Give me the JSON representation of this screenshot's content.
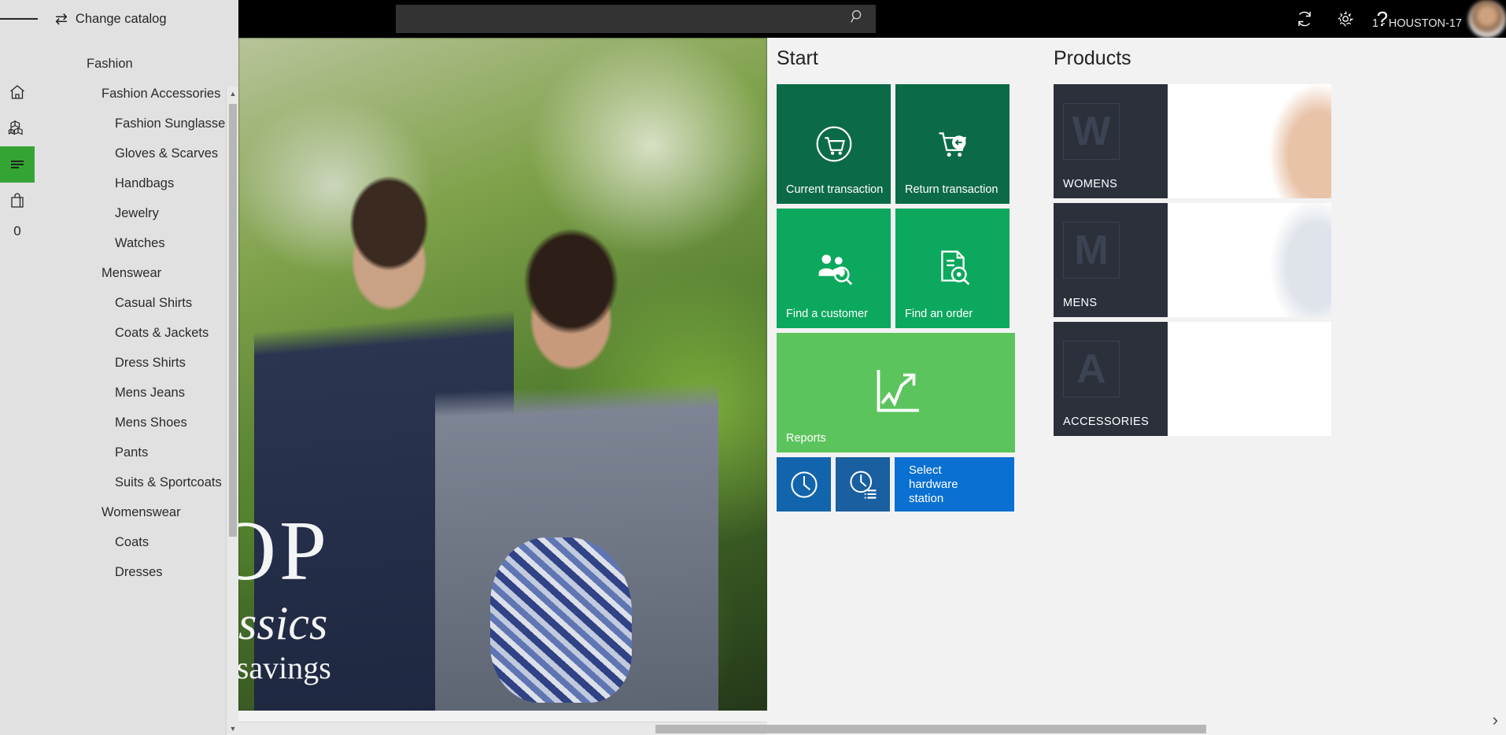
{
  "nav": {
    "hamburger_label": "menu-toggle",
    "change_catalog": "Change catalog",
    "swap_glyph": "⇄",
    "rail": [
      {
        "name": "home",
        "icon": "home-icon"
      },
      {
        "name": "products",
        "icon": "boxes-icon"
      },
      {
        "name": "catalog",
        "icon": "list-icon",
        "active": true
      },
      {
        "name": "cart",
        "icon": "shopping-bag-icon"
      }
    ],
    "cart_count": "0",
    "catalog": [
      {
        "label": "Fashion",
        "level": "group"
      },
      {
        "label": "Fashion Accessories",
        "level": "item"
      },
      {
        "label": "Fashion Sunglasses",
        "level": "sub"
      },
      {
        "label": "Gloves & Scarves",
        "level": "sub"
      },
      {
        "label": "Handbags",
        "level": "sub"
      },
      {
        "label": "Jewelry",
        "level": "sub"
      },
      {
        "label": "Watches",
        "level": "sub"
      },
      {
        "label": "Menswear",
        "level": "item"
      },
      {
        "label": "Casual Shirts",
        "level": "sub"
      },
      {
        "label": "Coats & Jackets",
        "level": "sub"
      },
      {
        "label": "Dress Shirts",
        "level": "sub"
      },
      {
        "label": "Mens Jeans",
        "level": "sub"
      },
      {
        "label": "Mens Shoes",
        "level": "sub"
      },
      {
        "label": "Pants",
        "level": "sub"
      },
      {
        "label": "Suits & Sportcoats",
        "level": "sub"
      },
      {
        "label": "Womenswear",
        "level": "item"
      },
      {
        "label": "Coats",
        "level": "sub"
      },
      {
        "label": "Dresses",
        "level": "sub"
      }
    ],
    "scroll_up_glyph": "▲",
    "scroll_down_glyph": "▼"
  },
  "topbar": {
    "search_placeholder": "",
    "search_value": "",
    "search_icon": "search-icon",
    "refresh_icon": "refresh-icon",
    "settings_icon": "gear-icon",
    "help_icon": "help-icon",
    "help_glyph": "?",
    "user_name": "",
    "store_register": "1 - HOUSTON-17"
  },
  "hero": {
    "line1": "OP",
    "line2": "assics",
    "line3": "e savings",
    "scroll_right_glyph": "›"
  },
  "start": {
    "title": "Start",
    "tiles": [
      {
        "label": "Current transaction",
        "icon": "cart-circle-icon",
        "color": "#0c6b47",
        "size": "sq"
      },
      {
        "label": "Return transaction",
        "icon": "cart-return-icon",
        "color": "#0c6b47",
        "size": "sq"
      },
      {
        "label": "Find a customer",
        "icon": "customers-search-icon",
        "color": "#0ca85e",
        "size": "sq"
      },
      {
        "label": "Find an order",
        "icon": "order-search-icon",
        "color": "#0ca85e",
        "size": "sq"
      },
      {
        "label": "Reports",
        "icon": "chart-up-icon",
        "color": "#5cc45c",
        "size": "wide"
      },
      {
        "label": "",
        "icon": "clock-icon",
        "color": "#1265ac",
        "size": "small"
      },
      {
        "label": "",
        "icon": "clock-list-icon",
        "color": "#1a5fa0",
        "size": "small"
      },
      {
        "label": "Select hardware station",
        "icon": "",
        "color": "#0a70d1",
        "size": "hw"
      }
    ]
  },
  "products": {
    "title": "Products",
    "items": [
      {
        "name": "WOMENS",
        "placeholder": "W"
      },
      {
        "name": "MENS",
        "placeholder": "M"
      },
      {
        "name": "ACCESSORIES",
        "placeholder": "A"
      }
    ],
    "next_glyph": "›"
  },
  "colors": {
    "tile_dark_green": "#0c6b47",
    "tile_green": "#0ca85e",
    "tile_light_green": "#5cc45c",
    "tile_blue": "#1265ac",
    "tile_blue_bright": "#0a70d1",
    "rail_active": "#34a434",
    "nav_bg": "#e1e1e1",
    "panel_bg": "#f2f2f2",
    "product_tile": "#2b303b",
    "topbar_bg": "#000000"
  }
}
